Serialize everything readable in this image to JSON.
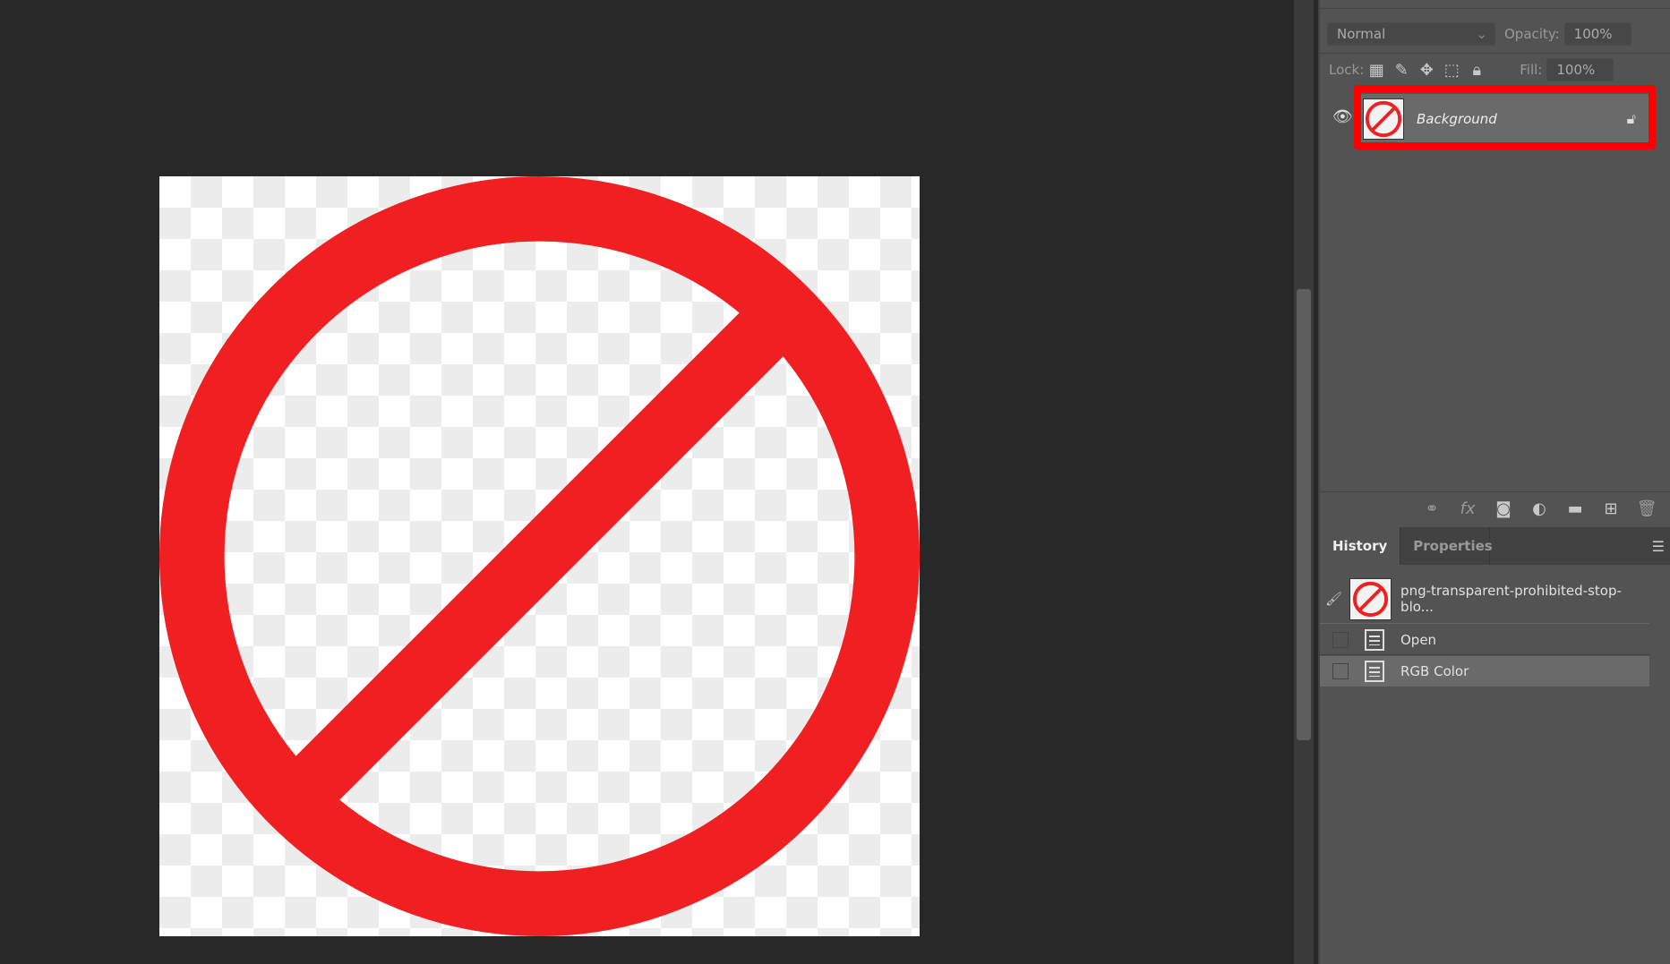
{
  "layers_panel": {
    "blend_mode": "Normal",
    "opacity_label": "Opacity:",
    "opacity_value": "100%",
    "lock_label": "Lock:",
    "fill_label": "Fill:",
    "fill_value": "100%",
    "layers": [
      {
        "name": "Background",
        "visible": true,
        "locked": true,
        "selected": true
      }
    ],
    "highlight_color": "#ff0000"
  },
  "history_panel": {
    "tabs": [
      {
        "label": "History",
        "active": true
      },
      {
        "label": "Properties",
        "active": false
      }
    ],
    "snapshot": "png-transparent-prohibited-stop-blo...",
    "states": [
      {
        "label": "Open"
      },
      {
        "label": "RGB Color",
        "selected": true
      }
    ]
  },
  "document": {
    "sign_color": "#f02022"
  }
}
